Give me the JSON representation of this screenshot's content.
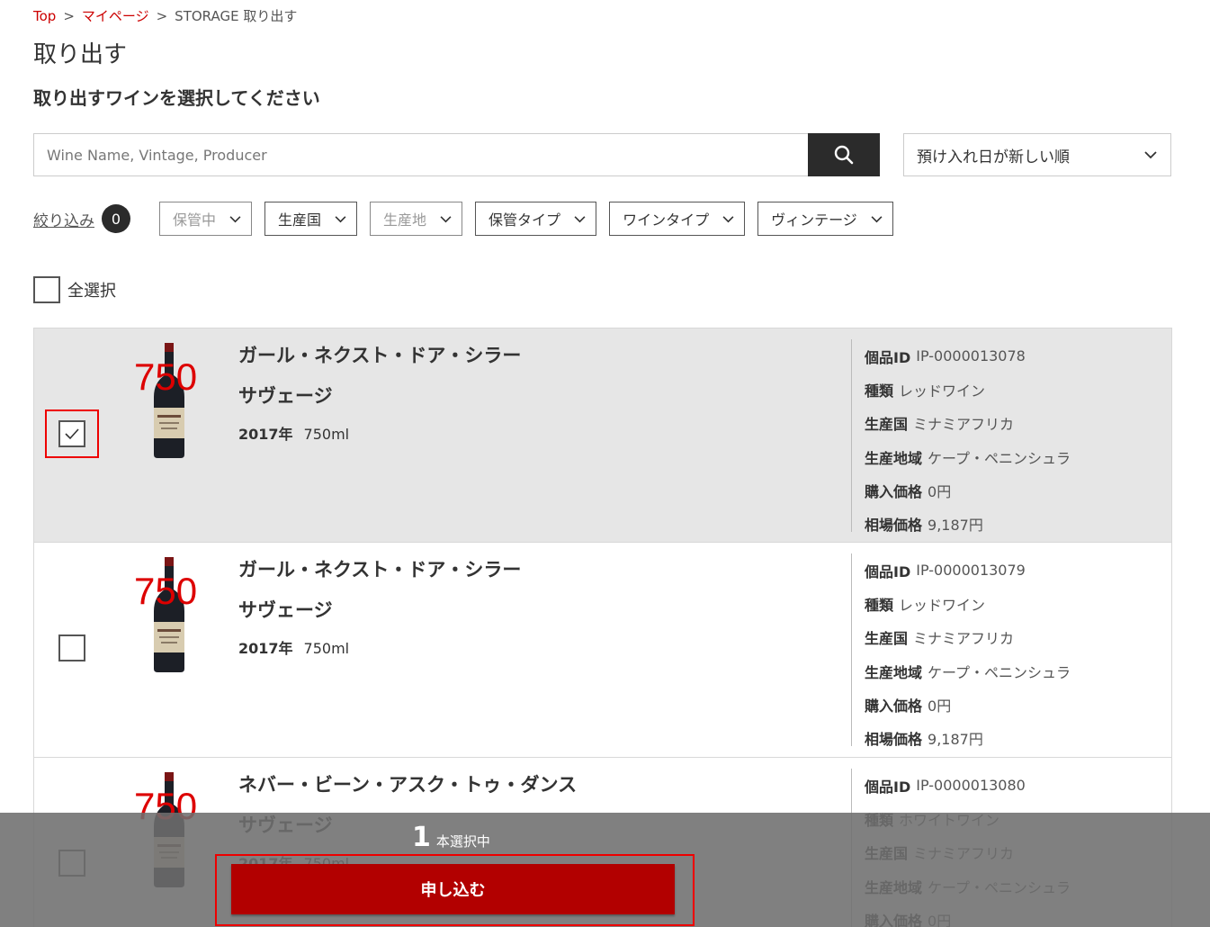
{
  "breadcrumb": {
    "top": "Top",
    "mypage": "マイページ",
    "current": "STORAGE 取り出す",
    "sep": ">"
  },
  "page_title": "取り出す",
  "subtitle": "取り出すワインを選択してください",
  "search": {
    "placeholder": "Wine Name, Vintage, Producer",
    "value": ""
  },
  "sort": {
    "selected": "預け入れ日が新しい順"
  },
  "filters": {
    "label": "絞り込み",
    "count": "0",
    "chips": [
      {
        "label": "保管中",
        "disabled": true
      },
      {
        "label": "生産国",
        "disabled": false
      },
      {
        "label": "生産地",
        "disabled": true
      },
      {
        "label": "保管タイプ",
        "disabled": false
      },
      {
        "label": "ワインタイプ",
        "disabled": false
      },
      {
        "label": "ヴィンテージ",
        "disabled": false
      }
    ]
  },
  "select_all_label": "全選択",
  "detail_labels": {
    "id": "個品ID",
    "type": "種類",
    "country": "生産国",
    "region": "生産地域",
    "purchase": "購入価格",
    "market": "相場価格"
  },
  "items": [
    {
      "selected": true,
      "thumb_label": "750",
      "name": "ガール・ネクスト・ドア・シラー",
      "producer": "サヴェージ",
      "vintage": "2017年",
      "volume": "750ml",
      "id": "IP-0000013078",
      "type": "レッドワイン",
      "country": "ミナミアフリカ",
      "region": "ケープ・ペニンシュラ",
      "purchase": "0円",
      "market": "9,187円"
    },
    {
      "selected": false,
      "thumb_label": "750",
      "name": "ガール・ネクスト・ドア・シラー",
      "producer": "サヴェージ",
      "vintage": "2017年",
      "volume": "750ml",
      "id": "IP-0000013079",
      "type": "レッドワイン",
      "country": "ミナミアフリカ",
      "region": "ケープ・ペニンシュラ",
      "purchase": "0円",
      "market": "9,187円"
    },
    {
      "selected": false,
      "thumb_label": "750",
      "name": "ネバー・ビーン・アスク・トゥ・ダンス",
      "producer": "サヴェージ",
      "vintage": "2017年",
      "volume": "750ml",
      "id": "IP-0000013080",
      "type": "ホワイトワイン",
      "country": "ミナミアフリカ",
      "region": "ケープ・ペニンシュラ",
      "purchase": "0円",
      "market": ""
    }
  ],
  "footer": {
    "count": "1",
    "count_label": "本選択中",
    "submit_label": "申し込む"
  },
  "colors": {
    "accent": "#b20000",
    "link": "#cc0000",
    "highlight": "#ee0000",
    "dark": "#2b2b2b"
  },
  "icons": {
    "search": "search-icon",
    "chevron": "chevron-down-icon",
    "check": "check-icon",
    "bottle": "wine-bottle-icon"
  }
}
